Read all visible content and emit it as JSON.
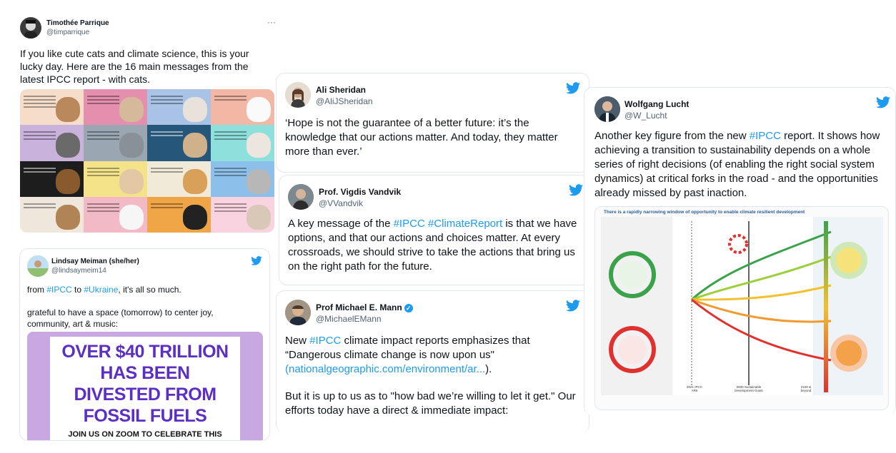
{
  "tweets": {
    "parrique": {
      "name": "Timothée Parrique",
      "handle": "@timparrique",
      "more": "···",
      "text": "If you like cute cats and climate science, this is your lucky day. Here are the 16 main messages from the latest IPCC report - with cats."
    },
    "meiman": {
      "name": "Lindsay Meiman (she/her)",
      "handle": "@lindsaymeim14",
      "line1_pre": "from ",
      "tag_ipcc": "#IPCC",
      "line1_mid": " to ",
      "tag_ukraine": "#Ukraine",
      "line1_post": ", it's all so much.",
      "line2": "grateful to have a space (tomorrow) to center joy, community, art & music:",
      "poster_big": "OVER $40 TRILLION HAS BEEN DIVESTED FROM FOSSIL FUELS",
      "poster_small": "JOIN US ON ZOOM TO CELEBRATE THIS MAJOR MOVEMENT VICTORY!"
    },
    "sheridan": {
      "name": "Ali Sheridan",
      "handle": "@AliJSheridan",
      "text": "‘Hope is not the guarantee of a better future: it’s the knowledge that our actions matter. And today, they matter more than ever.’"
    },
    "vandvik": {
      "name": "Prof. Vigdis Vandvik",
      "handle": "@VVandvik",
      "pre": "A key message of the ",
      "tag1": "#IPCC",
      "tag2": "#ClimateReport",
      "post": " is that we have options, and that our actions and choices matter. At every crossroads, we should strive to take the actions that bring us on the right path for the future."
    },
    "mann": {
      "name": "Prof Michael E. Mann",
      "handle": "@MichaelEMann",
      "pre": "New ",
      "tag": "#IPCC",
      "post": " climate impact reports emphasizes that “Dangerous climate change is now upon us\"",
      "link_open": "(",
      "link": "nationalgeographic.com/environment/ar...",
      "link_close": ").",
      "para2": "But it is up to us as to \"how bad we’re willing to let it get.\" Our efforts today have a direct & immediate impact:"
    },
    "lucht": {
      "name": "Wolfgang Lucht",
      "handle": "@W_Lucht",
      "pre": "Another key figure from the new ",
      "tag": "#IPCC",
      "post": " report. It shows how achieving a transition to sustainability depends on a whole series of right decisions (of enabling the right social system dynamics) at critical forks in the road - and the opportunities already missed by past inaction.",
      "figure_title": "There is a rapidly narrowing window of opportunity to enable climate resilient development",
      "figure_x_labels": [
        "2021 IPCC AR6",
        "2030 Sustainable Development Goals",
        "2100 & beyond"
      ]
    }
  },
  "colors": {
    "link": "#1d9bf0",
    "border": "#e1e8ed",
    "poster_bg": "#c9a7e0",
    "poster_text": "#5b2fc4"
  },
  "icons": {
    "brand": "twitter-bird-icon",
    "verified": "verified-badge-icon"
  }
}
